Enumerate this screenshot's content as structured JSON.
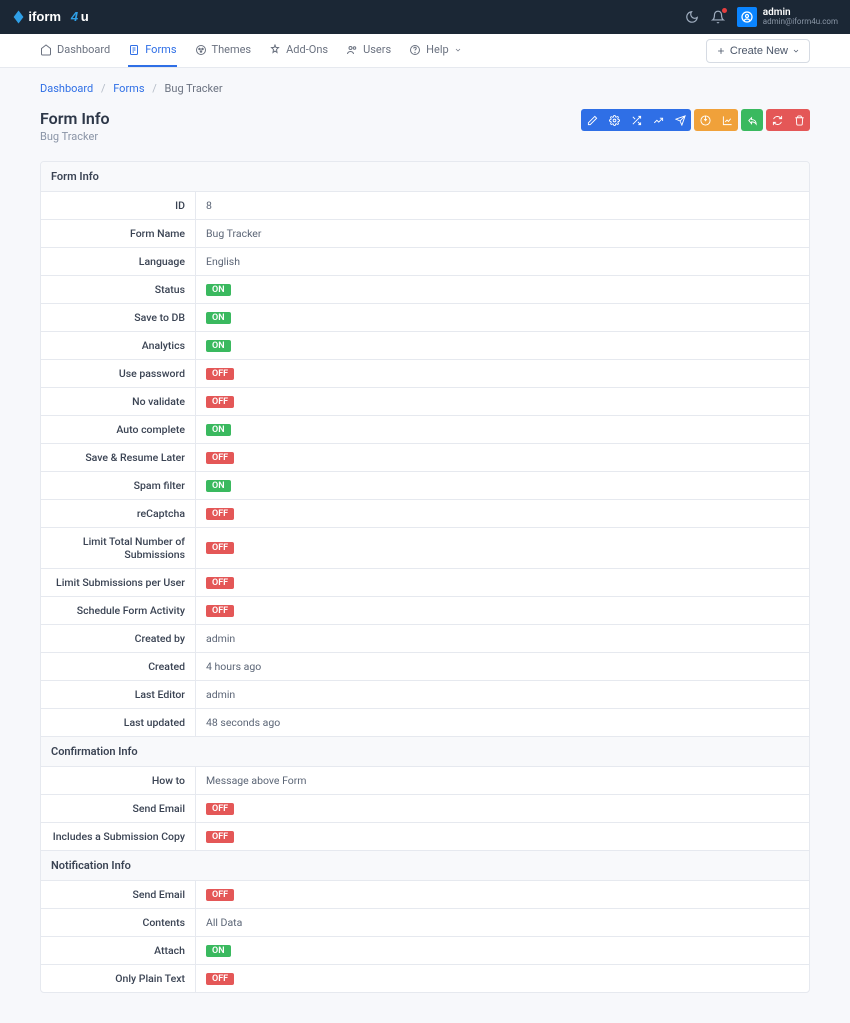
{
  "brand": {
    "name": "iform4u"
  },
  "user": {
    "name": "admin",
    "email": "admin@iform4u.com"
  },
  "nav": {
    "items": [
      {
        "label": "Dashboard"
      },
      {
        "label": "Forms"
      },
      {
        "label": "Themes"
      },
      {
        "label": "Add-Ons"
      },
      {
        "label": "Users"
      },
      {
        "label": "Help"
      }
    ],
    "create": "Create New"
  },
  "breadcrumb": {
    "a": "Dashboard",
    "b": "Forms",
    "c": "Bug Tracker"
  },
  "page": {
    "title": "Form Info",
    "subtitle": "Bug Tracker"
  },
  "badges": {
    "on": "ON",
    "off": "OFF"
  },
  "sections": {
    "formInfo": {
      "title": "Form Info",
      "rows": {
        "id": {
          "label": "ID",
          "value": "8"
        },
        "formName": {
          "label": "Form Name",
          "value": "Bug Tracker"
        },
        "language": {
          "label": "Language",
          "value": "English"
        },
        "status": {
          "label": "Status",
          "badge": "on"
        },
        "saveToDb": {
          "label": "Save to DB",
          "badge": "on"
        },
        "analytics": {
          "label": "Analytics",
          "badge": "on"
        },
        "usePassword": {
          "label": "Use password",
          "badge": "off"
        },
        "noValidate": {
          "label": "No validate",
          "badge": "off"
        },
        "autoComplete": {
          "label": "Auto complete",
          "badge": "on"
        },
        "saveResume": {
          "label": "Save & Resume Later",
          "badge": "off"
        },
        "spamFilter": {
          "label": "Spam filter",
          "badge": "on"
        },
        "recaptcha": {
          "label": "reCaptcha",
          "badge": "off"
        },
        "limitTotal": {
          "label": "Limit Total Number of Submissions",
          "badge": "off"
        },
        "limitUser": {
          "label": "Limit Submissions per User",
          "badge": "off"
        },
        "schedule": {
          "label": "Schedule Form Activity",
          "badge": "off"
        },
        "createdBy": {
          "label": "Created by",
          "value": "admin"
        },
        "created": {
          "label": "Created",
          "value": "4 hours ago"
        },
        "lastEditor": {
          "label": "Last Editor",
          "value": "admin"
        },
        "lastUpdated": {
          "label": "Last updated",
          "value": "48 seconds ago"
        }
      }
    },
    "confirmation": {
      "title": "Confirmation Info",
      "rows": {
        "howTo": {
          "label": "How to",
          "value": "Message above Form"
        },
        "sendEmail": {
          "label": "Send Email",
          "badge": "off"
        },
        "includesCopy": {
          "label": "Includes a Submission Copy",
          "badge": "off"
        }
      }
    },
    "notification": {
      "title": "Notification Info",
      "rows": {
        "sendEmail": {
          "label": "Send Email",
          "badge": "off"
        },
        "contents": {
          "label": "Contents",
          "value": "All Data"
        },
        "attach": {
          "label": "Attach",
          "badge": "on"
        },
        "plainText": {
          "label": "Only Plain Text",
          "badge": "off"
        }
      }
    }
  }
}
